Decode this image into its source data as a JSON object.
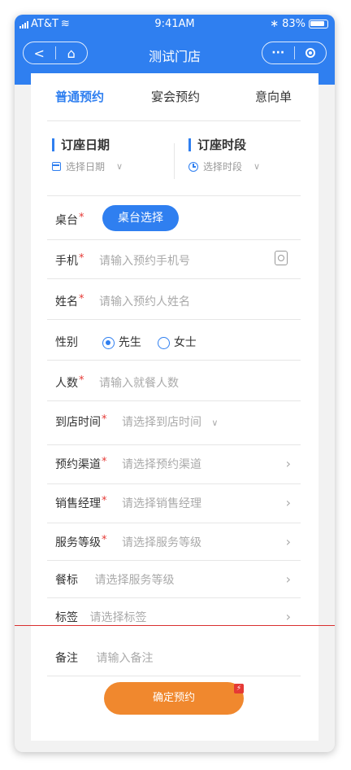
{
  "status_bar": {
    "carrier": "AT&T",
    "time": "9:41AM",
    "battery": "83%"
  },
  "nav": {
    "title": "测试门店",
    "back_icon": "<",
    "home_icon": "⌂",
    "more_icon": "···"
  },
  "tabs": [
    "普通预约",
    "宴会预约",
    "意向单"
  ],
  "date": {
    "title": "订座日期",
    "placeholder": "选择日期"
  },
  "period": {
    "title": "订座时段",
    "placeholder": "选择时段"
  },
  "fields": {
    "table": {
      "label": "桌台",
      "button": "桌台选择"
    },
    "phone": {
      "label": "手机",
      "placeholder": "请输入预约手机号"
    },
    "name": {
      "label": "姓名",
      "placeholder": "请输入预约人姓名"
    },
    "gender": {
      "label": "性别",
      "options": [
        "先生",
        "女士"
      ],
      "selected": "先生"
    },
    "count": {
      "label": "人数",
      "placeholder": "请输入就餐人数"
    },
    "arrival": {
      "label": "到店时间",
      "placeholder": "请选择到店时间"
    },
    "channel": {
      "label": "预约渠道",
      "placeholder": "请选择预约渠道"
    },
    "manager": {
      "label": "销售经理",
      "placeholder": "请选择销售经理"
    },
    "service": {
      "label": "服务等级",
      "placeholder": "请选择服务等级"
    },
    "meal": {
      "label": "餐标",
      "placeholder": "请选择服务等级"
    },
    "tag": {
      "label": "标签",
      "placeholder": "请选择标签"
    },
    "note": {
      "label": "备注",
      "placeholder": "请输入备注"
    }
  },
  "required_mark": "*",
  "confirm_button": "确定预约",
  "colors": {
    "primary": "#2f7ff0",
    "confirm": "#f0882e",
    "required": "#e53935"
  }
}
